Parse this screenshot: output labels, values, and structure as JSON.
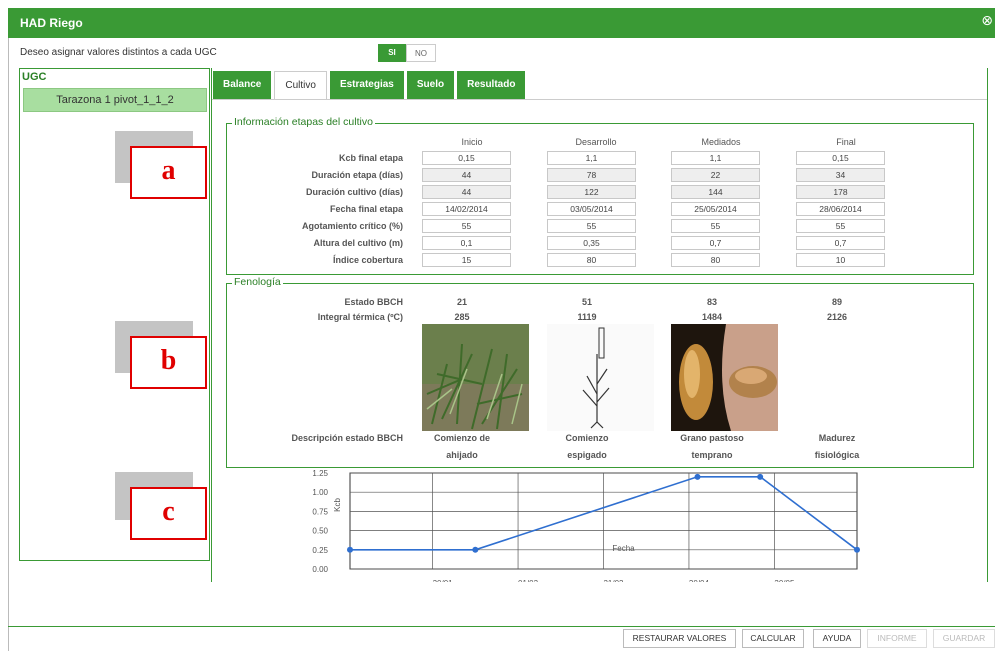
{
  "window": {
    "title": "HAD Riego",
    "close_icon": "close-icon"
  },
  "question": "Deseo asignar valores distintos a cada UGC",
  "toggle": {
    "yes": "SI",
    "no": "NO"
  },
  "sidebar": {
    "header": "UGC",
    "items": [
      "Tarazona 1 pivot_1_1_2"
    ]
  },
  "overlay_labels": [
    "a",
    "b",
    "c"
  ],
  "tabs": [
    "Balance",
    "Cultivo",
    "Estrategias",
    "Suelo",
    "Resultado"
  ],
  "stages": {
    "legend": "Información etapas del cultivo",
    "columns": [
      "Inicio",
      "Desarrollo",
      "Mediados",
      "Final"
    ],
    "rows": [
      {
        "label": "Kcb final etapa",
        "values": [
          "0,15",
          "1,1",
          "1,1",
          "0,15"
        ],
        "readonly": false
      },
      {
        "label": "Duración etapa (días)",
        "values": [
          "44",
          "78",
          "22",
          "34"
        ],
        "readonly": true
      },
      {
        "label": "Duración cultivo (días)",
        "values": [
          "44",
          "122",
          "144",
          "178"
        ],
        "readonly": true
      },
      {
        "label": "Fecha final etapa",
        "values": [
          "14/02/2014",
          "03/05/2014",
          "25/05/2014",
          "28/06/2014"
        ],
        "readonly": false
      },
      {
        "label": "Agotamiento crítico (%)",
        "values": [
          "55",
          "55",
          "55",
          "55"
        ],
        "readonly": false
      },
      {
        "label": "Altura del cultivo (m)",
        "values": [
          "0,1",
          "0,35",
          "0,7",
          "0,7"
        ],
        "readonly": false
      },
      {
        "label": "Índice cobertura",
        "values": [
          "15",
          "80",
          "80",
          "10"
        ],
        "readonly": false
      }
    ]
  },
  "phenology": {
    "legend": "Fenología",
    "bbch_label": "Estado BBCH",
    "bbch": [
      "21",
      "51",
      "83",
      "89"
    ],
    "thermal_label": "Integral térmica (ºC)",
    "thermal": [
      "285",
      "1119",
      "1484",
      "2126"
    ],
    "desc_label": "Descripción estado BBCH",
    "descriptions": [
      [
        "Comienzo de",
        "ahijado"
      ],
      [
        "Comienzo",
        "espigado"
      ],
      [
        "Grano pastoso",
        "temprano"
      ],
      [
        "Madurez",
        "fisiológica"
      ]
    ]
  },
  "chart_data": {
    "type": "line",
    "ylabel": "Kcb",
    "xlabel": "Fecha",
    "ylim": [
      0,
      1.25
    ],
    "yticks": [
      "1.25",
      "1.00",
      "0.75",
      "0.50",
      "0.25",
      "0.00"
    ],
    "xticks": [
      "30/01",
      "01/03",
      "31/03",
      "30/04",
      "30/05"
    ],
    "grid": true,
    "x": [
      "01/01/2014",
      "14/02/2014",
      "03/05/2014",
      "25/05/2014",
      "28/06/2014"
    ],
    "series": [
      {
        "values": [
          0.25,
          0.25,
          1.2,
          1.2,
          0.25
        ]
      }
    ],
    "color": "#2f6fd0"
  },
  "buttons": {
    "restore": "RESTAURAR VALORES",
    "calc": "CALCULAR",
    "help": "AYUDA",
    "report": "INFORME",
    "save": "GUARDAR"
  }
}
